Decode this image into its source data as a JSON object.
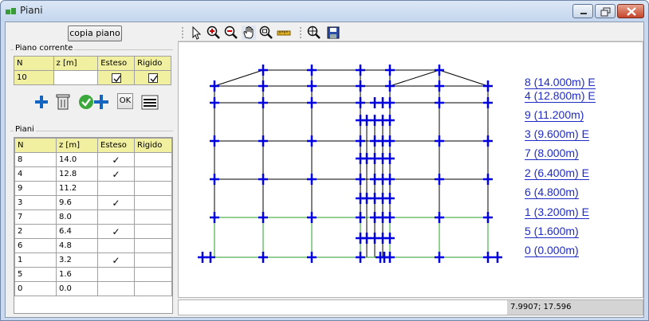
{
  "window": {
    "title": "Piani"
  },
  "left": {
    "copy_button": "copia piano",
    "current_group_label": "Piano corrente",
    "current_headers": [
      "N",
      "z [m]",
      "Esteso",
      "Rigido"
    ],
    "current_row": {
      "n": "10",
      "z": "",
      "esteso": true,
      "rigido": true
    },
    "ok_label": "OK",
    "floors_group_label": "Piani",
    "floors_headers": [
      "N",
      "z [m]",
      "Esteso",
      "Rigido"
    ],
    "floors": [
      {
        "n": "8",
        "z": "14.0",
        "esteso": "✓"
      },
      {
        "n": "4",
        "z": "12.8",
        "esteso": "✓"
      },
      {
        "n": "9",
        "z": "11.2",
        "esteso": ""
      },
      {
        "n": "3",
        "z": "9.6",
        "esteso": "✓"
      },
      {
        "n": "7",
        "z": "8.0",
        "esteso": ""
      },
      {
        "n": "2",
        "z": "6.4",
        "esteso": "✓"
      },
      {
        "n": "6",
        "z": "4.8",
        "esteso": ""
      },
      {
        "n": "1",
        "z": "3.2",
        "esteso": "✓"
      },
      {
        "n": "5",
        "z": "1.6",
        "esteso": ""
      },
      {
        "n": "0",
        "z": "0.0",
        "esteso": ""
      }
    ]
  },
  "toolbar": {
    "icons": [
      "pointer-icon",
      "zoom-in-icon",
      "zoom-out-icon",
      "pan-hand-icon",
      "zoom-window-icon",
      "measure-ruler-icon",
      "zoom-extents-icon",
      "save-icon"
    ]
  },
  "drawing": {
    "floor_labels": [
      "8  (14.000m)  E",
      "4  (12.800m)  E",
      "9  (11.200m)",
      "3  (9.600m)  E",
      "7  (8.000m)",
      "2  (6.400m)  E",
      "6  (4.800m)",
      "1  (3.200m)  E",
      "5  (1.600m)",
      "0  (0.000m)"
    ],
    "colors": {
      "node": "#0000e0",
      "frame": "#000000",
      "foundation": "#2aa02a",
      "label": "#1f2bc4"
    }
  },
  "status": {
    "coordinates": "7.9907; 17.596"
  }
}
